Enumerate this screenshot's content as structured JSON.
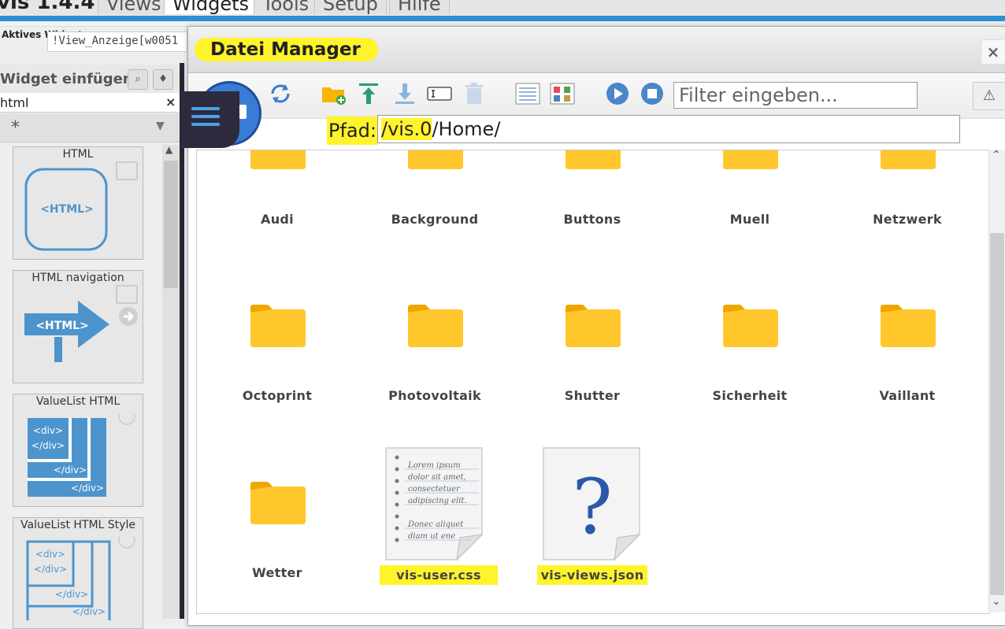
{
  "menubar": {
    "app_title": "vis 1.4.4",
    "tabs": [
      "Views",
      "Widgets",
      "Tools",
      "Setup",
      "Hilfe"
    ],
    "active_tab": "Widgets"
  },
  "sidebar": {
    "active_widget_label": "Aktives Widget:",
    "active_widget_value": "!View_Anzeige[w0051",
    "palette_title": "Widget einfügen",
    "filter_value": "html",
    "filter_clear": "×",
    "group_value": "*",
    "widgets": [
      {
        "title": "HTML",
        "icon": "html-rounded-box-icon"
      },
      {
        "title": "HTML navigation",
        "icon": "html-arrow-sign-icon"
      },
      {
        "title": "ValueList HTML",
        "icon": "div-nested-boxes-icon"
      },
      {
        "title": "ValueList HTML Style",
        "icon": "div-nested-outline-icon"
      }
    ],
    "icon_texts": {
      "html": "<HTML>",
      "div_open": "<div>",
      "div_close": "</div>"
    }
  },
  "dialog": {
    "title": "Datei Manager",
    "close": "×",
    "filter_placeholder": "Filter eingeben...",
    "path_label": "Pfad:",
    "path_highlight": "/vis.0",
    "path_rest": "/Home/",
    "toolbar": [
      "refresh-icon",
      "new-folder-icon",
      "upload-icon",
      "download-icon",
      "rename-icon",
      "delete-icon",
      "list-view-icon",
      "table-view-icon",
      "play-icon",
      "stop-icon"
    ],
    "folders": [
      "Audi",
      "Background",
      "Buttons",
      "Muell",
      "Netzwerk",
      "Octoprint",
      "Photovoltaik",
      "Shutter",
      "Sicherheit",
      "Vaillant",
      "Wetter"
    ],
    "files": [
      {
        "name": "vis-user.css",
        "icon": "text-document-icon",
        "highlighted": true
      },
      {
        "name": "vis-views.json",
        "icon": "unknown-file-icon",
        "highlighted": true
      }
    ],
    "doc_lines": [
      "Lorem ipsum",
      "dolor sit amet,",
      "consectetuer",
      "adipiscing elit.",
      "Donec aliquet",
      "diam ut ene"
    ]
  },
  "colors": {
    "highlight": "#fff32b",
    "folder": "#ffc72c",
    "accent_blue": "#2e8ed6"
  }
}
